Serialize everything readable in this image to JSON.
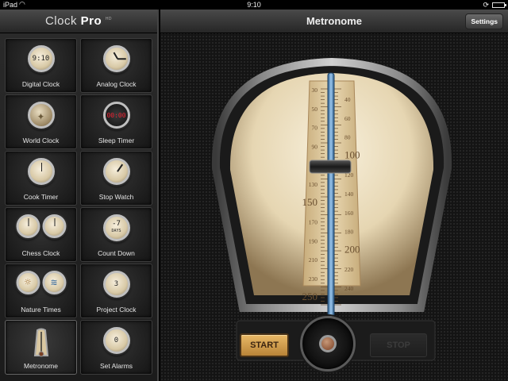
{
  "status": {
    "carrier": "iPad",
    "time": "9:10",
    "battery_level": 0.85
  },
  "sidebar": {
    "brand_name": "Clock",
    "brand_pro": "Pro",
    "brand_mark": "HD",
    "items": [
      {
        "label": "Digital Clock",
        "icon": "digital-clock-icon",
        "dial_text": "9:10"
      },
      {
        "label": "Analog Clock",
        "icon": "analog-clock-icon"
      },
      {
        "label": "World Clock",
        "icon": "globe-icon"
      },
      {
        "label": "Sleep Timer",
        "icon": "sleep-timer-icon",
        "dial_text": "00:00"
      },
      {
        "label": "Cook Timer",
        "icon": "cook-timer-icon"
      },
      {
        "label": "Stop Watch",
        "icon": "stopwatch-icon"
      },
      {
        "label": "Chess Clock",
        "icon": "chess-clock-icon"
      },
      {
        "label": "Count Down",
        "icon": "countdown-icon",
        "dial_text": "-7",
        "dial_sub": "DAYS"
      },
      {
        "label": "Nature Times",
        "icon": "nature-times-icon"
      },
      {
        "label": "Project Clock",
        "icon": "project-clock-icon",
        "dial_text": "3"
      },
      {
        "label": "Metronome",
        "icon": "metronome-icon",
        "active": true
      },
      {
        "label": "Set Alarms",
        "icon": "alarm-icon",
        "dial_text": "0"
      }
    ]
  },
  "main": {
    "title": "Metronome",
    "settings_label": "Settings",
    "start_label": "START",
    "stop_label": "STOP",
    "left_scale": [
      "30",
      "50",
      "70",
      "90",
      "110",
      "130",
      "150",
      "170",
      "190",
      "210",
      "230",
      "250"
    ],
    "right_scale": [
      "40",
      "60",
      "80",
      "100",
      "120",
      "140",
      "160",
      "180",
      "200",
      "220",
      "240"
    ],
    "big_labels": [
      "150",
      "250",
      "100",
      "200"
    ],
    "tempo_bpm": 120
  },
  "colors": {
    "accent": "#c8953f",
    "face": "#efe3c6",
    "pendulum": "#4a88c0"
  }
}
